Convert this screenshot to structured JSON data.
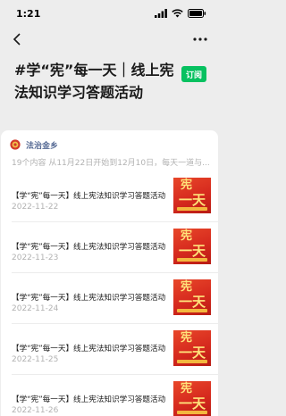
{
  "status_bar": {
    "time": "1:21"
  },
  "header": {
    "title": "#学“宪”每一天｜线上宪法知识学习答题活动",
    "subscribe_label": "订阅"
  },
  "account": {
    "name": "法治金乡",
    "meta": "19个内容  从11月22日开始到12月10日，每天一道与..."
  },
  "articles": [
    {
      "title": "【学“宪”每一天】线上宪法知识学习答题活动",
      "date": "2022-11-22",
      "thumb_line1": "宪",
      "thumb_line2": "一天"
    },
    {
      "title": "【学“宪”每一天】线上宪法知识学习答题活动",
      "date": "2022-11-23",
      "thumb_line1": "宪",
      "thumb_line2": "一天"
    },
    {
      "title": "【学“宪”每一天】线上宪法知识学习答题活动",
      "date": "2022-11-24",
      "thumb_line1": "宪",
      "thumb_line2": "一天"
    },
    {
      "title": "【学“宪”每一天】线上宪法知识学习答题活动",
      "date": "2022-11-25",
      "thumb_line1": "宪",
      "thumb_line2": "一天"
    },
    {
      "title": "【学“宪”每一天】线上宪法知识学习答题活动",
      "date": "2022-11-26",
      "thumb_line1": "宪",
      "thumb_line2": "一天"
    }
  ],
  "colors": {
    "accent": "#07c160",
    "link": "#576b95",
    "thumb_red": "#d62a1e"
  }
}
